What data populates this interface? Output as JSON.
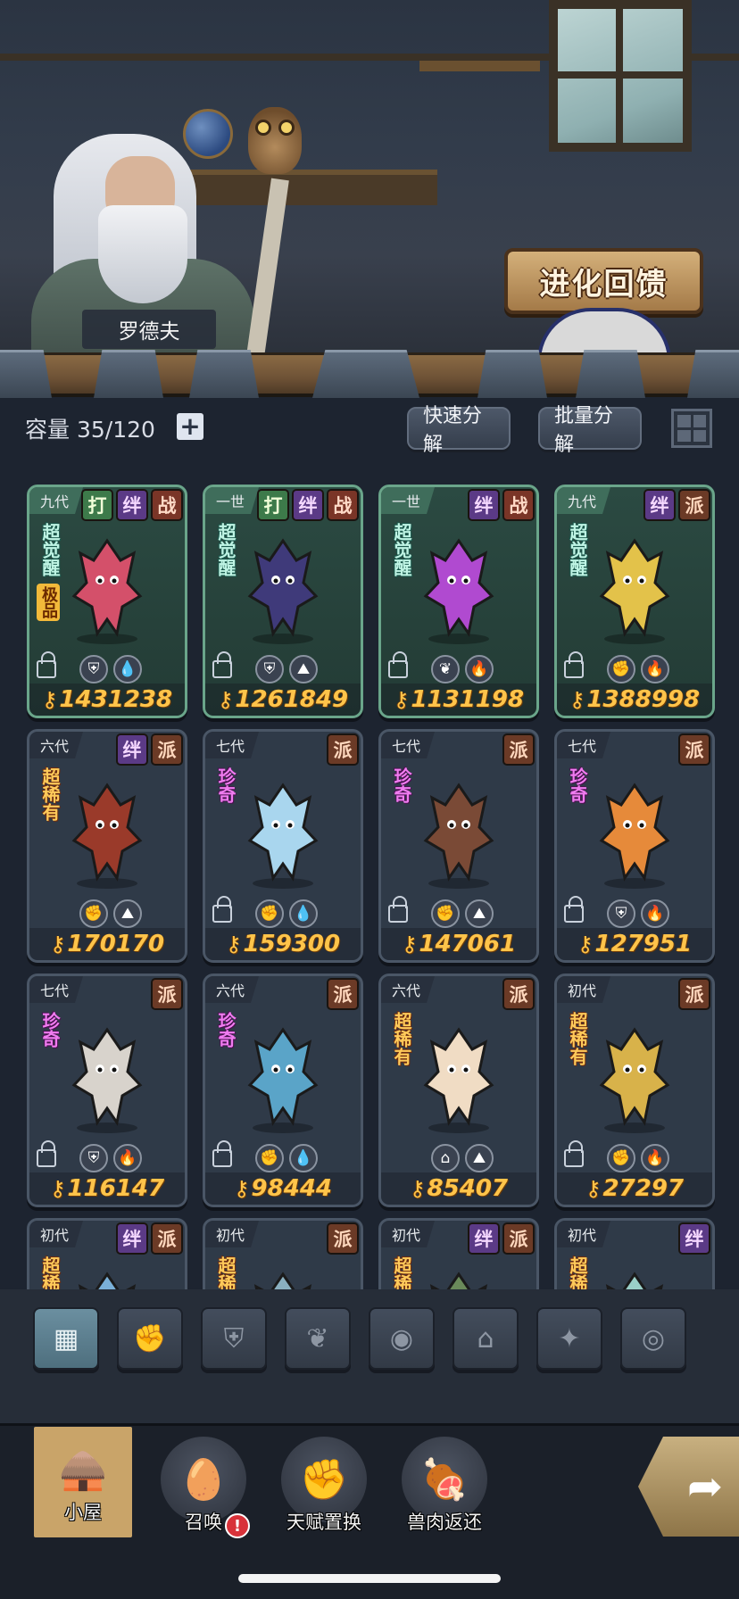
{
  "scene": {
    "npc_name": "罗德夫",
    "evolution_button": "进化回馈"
  },
  "capacity": {
    "label": "容量",
    "value": "35/120",
    "add_symbol": "+"
  },
  "actions": {
    "quick_decompose": "快速分解",
    "batch_decompose": "批量分解"
  },
  "cards": [
    {
      "generation": "九代",
      "tags": [
        "打",
        "绊",
        "战"
      ],
      "rarity": "超觉醒",
      "extra_badge": "极品",
      "elements": [
        "shield",
        "water"
      ],
      "power": "1431238",
      "style": "green",
      "locked": true
    },
    {
      "generation": "一世",
      "tags": [
        "打",
        "绊",
        "战"
      ],
      "rarity": "超觉醒",
      "extra_badge": "",
      "elements": [
        "shield",
        "earth"
      ],
      "power": "1261849",
      "style": "green",
      "locked": true
    },
    {
      "generation": "一世",
      "tags": [
        "绊",
        "战"
      ],
      "rarity": "超觉醒",
      "extra_badge": "",
      "elements": [
        "plant",
        "fire"
      ],
      "power": "1131198",
      "style": "green",
      "locked": true
    },
    {
      "generation": "九代",
      "tags": [
        "绊",
        "派"
      ],
      "rarity": "超觉醒",
      "extra_badge": "",
      "elements": [
        "claw",
        "fire"
      ],
      "power": "1388998",
      "style": "green",
      "locked": true
    },
    {
      "generation": "六代",
      "tags": [
        "绊",
        "派"
      ],
      "rarity": "超稀有",
      "extra_badge": "",
      "elements": [
        "claw",
        "earth"
      ],
      "power": "170170",
      "style": "slate",
      "locked": false
    },
    {
      "generation": "七代",
      "tags": [
        "派"
      ],
      "rarity": "珍奇",
      "extra_badge": "",
      "elements": [
        "claw",
        "water"
      ],
      "power": "159300",
      "style": "slate",
      "locked": true
    },
    {
      "generation": "七代",
      "tags": [
        "派"
      ],
      "rarity": "珍奇",
      "extra_badge": "",
      "elements": [
        "claw",
        "earth"
      ],
      "power": "147061",
      "style": "slate",
      "locked": true
    },
    {
      "generation": "七代",
      "tags": [
        "派"
      ],
      "rarity": "珍奇",
      "extra_badge": "",
      "elements": [
        "shield",
        "fire"
      ],
      "power": "127951",
      "style": "slate",
      "locked": true
    },
    {
      "generation": "七代",
      "tags": [
        "派"
      ],
      "rarity": "珍奇",
      "extra_badge": "",
      "elements": [
        "shield",
        "fire"
      ],
      "power": "116147",
      "style": "slate",
      "locked": true
    },
    {
      "generation": "六代",
      "tags": [
        "派"
      ],
      "rarity": "珍奇",
      "extra_badge": "",
      "elements": [
        "claw",
        "water"
      ],
      "power": "98444",
      "style": "slate",
      "locked": true
    },
    {
      "generation": "六代",
      "tags": [
        "派"
      ],
      "rarity": "超稀有",
      "extra_badge": "",
      "elements": [
        "temple",
        "earth"
      ],
      "power": "85407",
      "style": "slate",
      "locked": false
    },
    {
      "generation": "初代",
      "tags": [
        "派"
      ],
      "rarity": "超稀有",
      "extra_badge": "",
      "elements": [
        "claw",
        "fire"
      ],
      "power": "27297",
      "style": "slate",
      "locked": true
    },
    {
      "generation": "初代",
      "tags": [
        "绊",
        "派"
      ],
      "rarity": "超稀",
      "extra_badge": "",
      "elements": [],
      "power": "",
      "style": "slate",
      "locked": false
    },
    {
      "generation": "初代",
      "tags": [
        "派"
      ],
      "rarity": "超稀",
      "extra_badge": "",
      "elements": [],
      "power": "",
      "style": "slate",
      "locked": false
    },
    {
      "generation": "初代",
      "tags": [
        "绊",
        "派"
      ],
      "rarity": "超稀",
      "extra_badge": "",
      "elements": [],
      "power": "",
      "style": "slate",
      "locked": false
    },
    {
      "generation": "初代",
      "tags": [
        "绊"
      ],
      "rarity": "超稀",
      "extra_badge": "",
      "elements": [],
      "power": "",
      "style": "slate",
      "locked": false
    }
  ],
  "filters": [
    "all-icon",
    "claw-icon",
    "shield-icon",
    "plant-icon",
    "egg-icon",
    "temple-icon",
    "star-icon",
    "swirl-icon"
  ],
  "bottom_nav": {
    "items": [
      {
        "label": "小屋",
        "icon": "hut-icon",
        "active": true
      },
      {
        "label": "召唤",
        "icon": "egg-icon",
        "active": false,
        "alert": "!"
      },
      {
        "label": "天赋置换",
        "icon": "fist-icon",
        "active": false
      },
      {
        "label": "兽肉返还",
        "icon": "meat-icon",
        "active": false
      }
    ],
    "go_button_icon": "arrow-icon"
  },
  "colors": {
    "power_gold": "#ffc44a",
    "card_green_border": "#6aa58a",
    "tag_ban": "#5b3a86",
    "tag_zhan": "#7a3527",
    "tag_da": "#3d7a4a",
    "alert_red": "#d8323a"
  }
}
